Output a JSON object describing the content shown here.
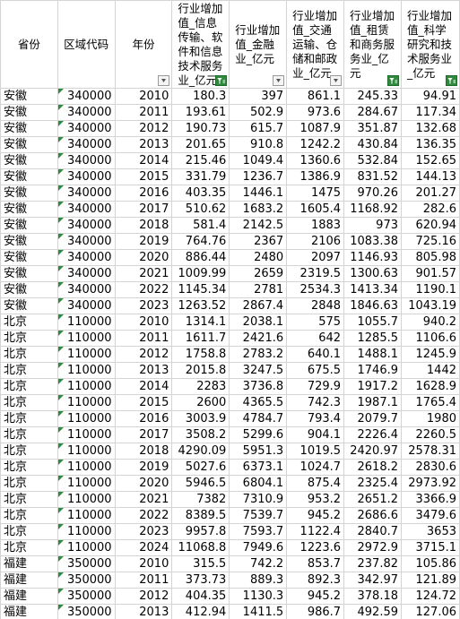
{
  "columns": [
    {
      "label": "省份",
      "filter": "none"
    },
    {
      "label": "区域代码",
      "filter": "none"
    },
    {
      "label": "年份",
      "filter": "dropdown"
    },
    {
      "label": "行业增加值_信息传输、软件和信息技术服务业_亿元",
      "filter": "active"
    },
    {
      "label": "行业增加值_金融业_亿元",
      "filter": "dropdown"
    },
    {
      "label": "行业增加值_交通运输、仓储和邮政业_亿元",
      "filter": "dropdown"
    },
    {
      "label": "行业增加值_租赁和商务服务业_亿元",
      "filter": "active"
    },
    {
      "label": "行业增加值_科学研究和技术服务业_亿元",
      "filter": "active"
    }
  ],
  "rows": [
    [
      "安徽",
      "340000",
      "2010",
      "180.3",
      "397",
      "861.1",
      "245.33",
      "94.91"
    ],
    [
      "安徽",
      "340000",
      "2011",
      "193.61",
      "502.9",
      "973.6",
      "284.67",
      "117.34"
    ],
    [
      "安徽",
      "340000",
      "2012",
      "190.73",
      "615.7",
      "1087.9",
      "351.87",
      "132.68"
    ],
    [
      "安徽",
      "340000",
      "2013",
      "201.65",
      "910.8",
      "1242.2",
      "430.84",
      "136.35"
    ],
    [
      "安徽",
      "340000",
      "2014",
      "215.46",
      "1049.4",
      "1360.6",
      "532.84",
      "152.65"
    ],
    [
      "安徽",
      "340000",
      "2015",
      "331.79",
      "1236.7",
      "1386.9",
      "831.52",
      "144.13"
    ],
    [
      "安徽",
      "340000",
      "2016",
      "403.35",
      "1446.1",
      "1475",
      "970.26",
      "201.27"
    ],
    [
      "安徽",
      "340000",
      "2017",
      "510.62",
      "1683.2",
      "1605.4",
      "1168.92",
      "282.6"
    ],
    [
      "安徽",
      "340000",
      "2018",
      "581.4",
      "2142.5",
      "1883",
      "973",
      "620.94"
    ],
    [
      "安徽",
      "340000",
      "2019",
      "764.76",
      "2367",
      "2106",
      "1083.38",
      "725.16"
    ],
    [
      "安徽",
      "340000",
      "2020",
      "886.44",
      "2480",
      "2097",
      "1146.93",
      "805.98"
    ],
    [
      "安徽",
      "340000",
      "2021",
      "1009.99",
      "2659",
      "2319.5",
      "1300.63",
      "901.57"
    ],
    [
      "安徽",
      "340000",
      "2022",
      "1145.34",
      "2781",
      "2534.3",
      "1413.34",
      "1190.1"
    ],
    [
      "安徽",
      "340000",
      "2023",
      "1263.52",
      "2867.4",
      "2848",
      "1846.63",
      "1043.19"
    ],
    [
      "北京",
      "110000",
      "2010",
      "1314.1",
      "2038.1",
      "575",
      "1055.7",
      "940.2"
    ],
    [
      "北京",
      "110000",
      "2011",
      "1611.7",
      "2421.6",
      "642",
      "1285.5",
      "1106.6"
    ],
    [
      "北京",
      "110000",
      "2012",
      "1758.8",
      "2783.2",
      "640.1",
      "1488.1",
      "1245.9"
    ],
    [
      "北京",
      "110000",
      "2013",
      "2015.8",
      "3247.5",
      "675.5",
      "1746.9",
      "1442"
    ],
    [
      "北京",
      "110000",
      "2014",
      "2283",
      "3736.8",
      "729.9",
      "1917.2",
      "1628.9"
    ],
    [
      "北京",
      "110000",
      "2015",
      "2600",
      "4365.5",
      "742.3",
      "1987.1",
      "1765.4"
    ],
    [
      "北京",
      "110000",
      "2016",
      "3003.9",
      "4784.7",
      "793.4",
      "2079.7",
      "1980"
    ],
    [
      "北京",
      "110000",
      "2017",
      "3508.2",
      "5299.6",
      "904.1",
      "2226.4",
      "2260.5"
    ],
    [
      "北京",
      "110000",
      "2018",
      "4290.09",
      "5951.3",
      "1019.5",
      "2420.97",
      "2578.31"
    ],
    [
      "北京",
      "110000",
      "2019",
      "5027.6",
      "6373.1",
      "1024.7",
      "2618.2",
      "2830.6"
    ],
    [
      "北京",
      "110000",
      "2020",
      "5946.5",
      "6804.1",
      "875.4",
      "2325.4",
      "2973.92"
    ],
    [
      "北京",
      "110000",
      "2021",
      "7382",
      "7310.9",
      "953.2",
      "2651.2",
      "3366.9"
    ],
    [
      "北京",
      "110000",
      "2022",
      "8389.5",
      "7539.7",
      "945.2",
      "2686.6",
      "3479.6"
    ],
    [
      "北京",
      "110000",
      "2023",
      "9957.8",
      "7593.7",
      "1122.4",
      "2840.7",
      "3653"
    ],
    [
      "北京",
      "110000",
      "2024",
      "11068.8",
      "7949.6",
      "1223.6",
      "2972.9",
      "3715.1"
    ],
    [
      "福建",
      "350000",
      "2010",
      "315.5",
      "742.2",
      "853.7",
      "237.82",
      "105.86"
    ],
    [
      "福建",
      "350000",
      "2011",
      "373.73",
      "889.3",
      "892.3",
      "342.97",
      "121.89"
    ],
    [
      "福建",
      "350000",
      "2012",
      "404.35",
      "1130.3",
      "945.2",
      "378.18",
      "124.72"
    ],
    [
      "福建",
      "350000",
      "2013",
      "412.94",
      "1411.5",
      "986.7",
      "492.59",
      "127.06"
    ]
  ]
}
